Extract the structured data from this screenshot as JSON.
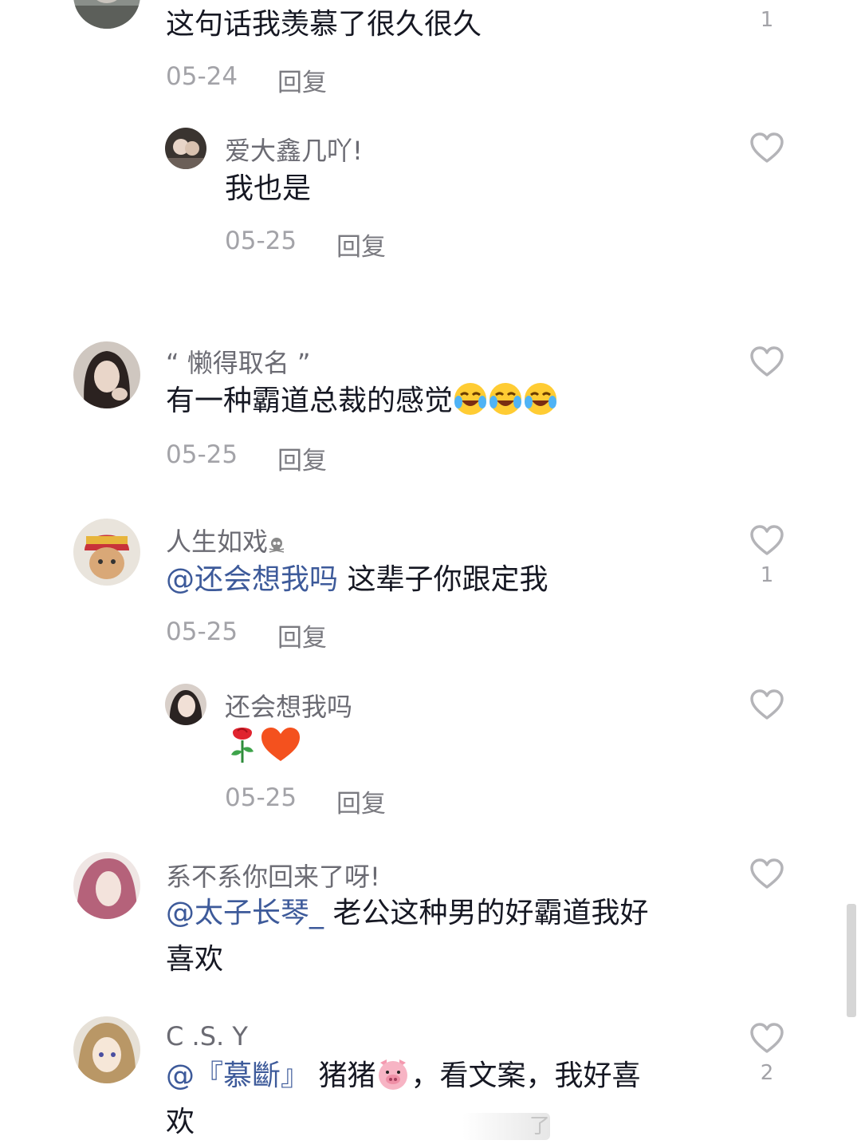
{
  "colors": {
    "text": "#161823",
    "username": "#6b6b73",
    "meta": "#a3a3a8",
    "mention": "#3d5a9a",
    "heart_outline": "#b4b4b8"
  },
  "comments": [
    {
      "id": "c1",
      "content": "这句话我羡慕了很久很久",
      "date": "05-24",
      "reply_label": "回复",
      "likes": "1",
      "replies": [
        {
          "username": "爱大鑫几吖!",
          "content": "我也是",
          "date": "05-25",
          "reply_label": "回复",
          "likes": ""
        }
      ]
    },
    {
      "id": "c2",
      "username": "“ 懒得取名 ”",
      "content": "有一种霸道总裁的感觉",
      "emojis": [
        "crying-laughing-emoji",
        "crying-laughing-emoji",
        "crying-laughing-emoji"
      ],
      "date": "05-25",
      "reply_label": "回复",
      "likes": ""
    },
    {
      "id": "c3",
      "username": "人生如戏",
      "username_suffix_icon": "skull-icon",
      "mention": "@还会想我吗",
      "content": " 这辈子你跟定我",
      "date": "05-25",
      "reply_label": "回复",
      "likes": "1",
      "replies": [
        {
          "username": "还会想我吗",
          "emojis": [
            "rose-emoji",
            "orange-heart-emoji"
          ],
          "date": "05-25",
          "reply_label": "回复",
          "likes": ""
        }
      ]
    },
    {
      "id": "c4",
      "username": "系不系你回来了呀!",
      "mention": "@太子长琴_",
      "content_line1": " 老公这种男的好霸道我好",
      "content_line2": "喜欢",
      "likes": ""
    },
    {
      "id": "c5",
      "username": "C .S. Y",
      "mention": "@『慕斷』",
      "content_part1": " 猪猪",
      "emojis": [
        "pig-face-emoji"
      ],
      "content_part2": "，看文案，我好喜",
      "content_line2": "欢",
      "likes": "2"
    }
  ],
  "watermark_text": "了"
}
